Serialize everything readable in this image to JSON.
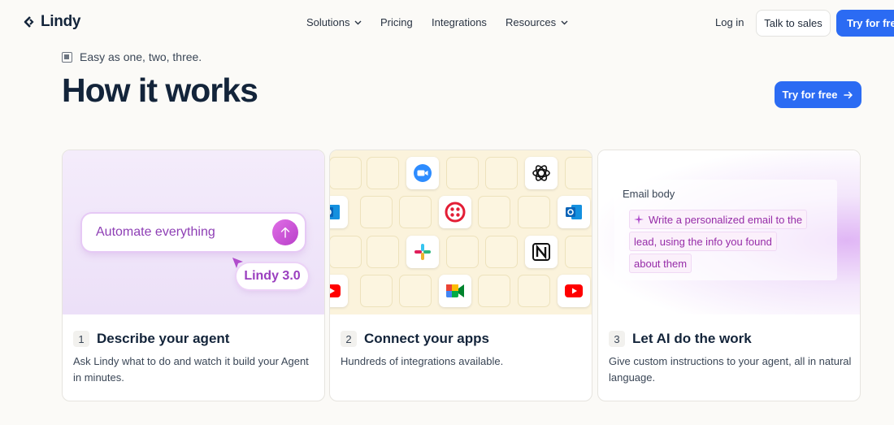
{
  "nav": {
    "logo_text": "Lindy",
    "links": [
      "Solutions",
      "Pricing",
      "Integrations",
      "Resources"
    ],
    "login": "Log in",
    "talk_to_sales": "Talk to sales",
    "try_free": "Try for free"
  },
  "hero": {
    "eyebrow": "Easy as one, two, three.",
    "title": "How it works",
    "cta": "Try for free"
  },
  "cards": [
    {
      "number": "1",
      "title": "Describe your agent",
      "description": "Ask Lindy what to do and watch it build your Agent in minutes.",
      "visual": {
        "prompt": "Automate everything",
        "badge": "Lindy 3.0"
      }
    },
    {
      "number": "2",
      "title": "Connect your apps",
      "description": "Hundreds of integrations available.",
      "visual": {
        "apps": [
          "zoom-icon",
          "openai-icon",
          "outlook-icon",
          "twilio-icon",
          "slack-icon",
          "notion-icon",
          "youtube-icon",
          "google-meet-icon"
        ]
      }
    },
    {
      "number": "3",
      "title": "Let AI do the work",
      "description": "Give custom instructions to your agent, all in natural language.",
      "visual": {
        "label": "Email body",
        "lines": [
          "Write a personalized email to the",
          "lead, using the info you found",
          "about them"
        ]
      }
    }
  ],
  "colors": {
    "primary": "#2b6bf3",
    "heading": "#13243a",
    "accent_purple": "#9a3fbf"
  }
}
